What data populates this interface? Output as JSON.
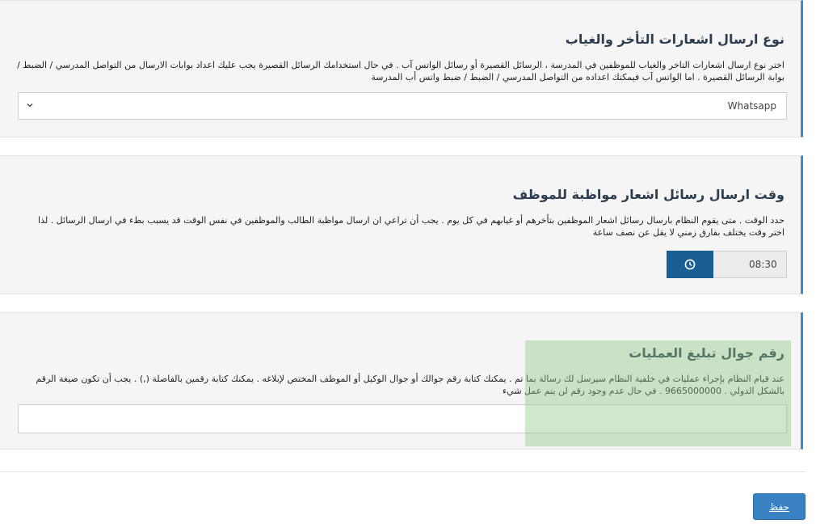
{
  "sections": {
    "notification_type": {
      "title": "نوع ارسال اشعارات التأخر والغياب",
      "description_line1": "اختر نوع ارسال اشعارات التاخر والغياب للموظفين في المدرسة ، الرسائل القصيرة أو رسائل الواتس آب . في حال استخدامك الرسائل القصيرة يجب عليك اعداد بوابات الارسال من التواصل المدرسي / الضبط /",
      "description_line2": "بوابة الرسائل القصيرة . اما الواتس آب فيمكنك اعداده من التواصل المدرسي / الضبط / ضبط واتس أب المدرسة",
      "selected_value": "Whatsapp"
    },
    "send_time": {
      "title": "وقت ارسال رسائل اشعار مواظبة للموظف",
      "description_line1": "حدد الوقت . متى يقوم النظام بارسال رسائل اشعار الموظفين بتأخرهم أو غيابهم في كل يوم . يجب أن تراعي ان ارسال مواظبة الطالب والموظفين في نفس الوقت قد يسبب بطء في ارسال الرسائل . لذا",
      "description_line2": "اختر وقت يختلف بفارق زمني لا يقل عن نصف ساعة",
      "time_value": "08:30"
    },
    "operations_mobile": {
      "title": "رقم جوال تبليغ العمليات",
      "description_line1": "عند قيام النظام بإجراء عمليات في خلفية النظام سيرسل لك رسالة بما تم . يمكنك كتابة رقم جوالك أو جوال الوكيل أو الموظف المختص لإبلاغه . يمكنك كتابة رقمين بالفاصلة (,) . يجب أن تكون صيغة الرقم",
      "description_line2": "بالشكل الدولي . 9665000000 . في حال عدم وجود رقم لن يتم عمل شيء",
      "input_value": ""
    }
  },
  "save_label": "حفظ",
  "colors": {
    "accent": "#3a8ad0",
    "clock_button": "#1a5f94",
    "save_button": "#3a82c4",
    "highlight": "#8cc882"
  },
  "icons": {
    "select_chevron": "chevron-down-icon",
    "clock": "clock-icon"
  }
}
